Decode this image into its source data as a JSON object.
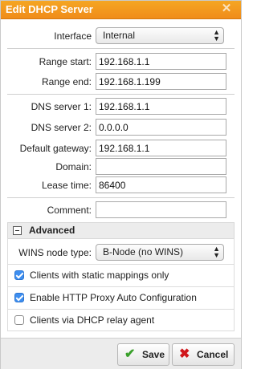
{
  "dialog": {
    "title": "Edit DHCP Server"
  },
  "form": {
    "interface": {
      "label": "Interface",
      "value": "Internal"
    },
    "range_start": {
      "label": "Range start:",
      "value": "192.168.1.1"
    },
    "range_end": {
      "label": "Range end:",
      "value": "192.168.1.199"
    },
    "dns1": {
      "label": "DNS server 1:",
      "value": "192.168.1.1"
    },
    "dns2": {
      "label": "DNS server 2:",
      "value": "0.0.0.0"
    },
    "gateway": {
      "label": "Default gateway:",
      "value": "192.168.1.1"
    },
    "domain": {
      "label": "Domain:",
      "value": ""
    },
    "lease": {
      "label": "Lease time:",
      "value": "86400"
    },
    "comment": {
      "label": "Comment:",
      "value": ""
    }
  },
  "advanced": {
    "title": "Advanced",
    "wins": {
      "label": "WINS node type:",
      "value": "B-Node (no WINS)"
    },
    "options": [
      {
        "label": "Clients with static mappings only",
        "checked": true
      },
      {
        "label": "Enable HTTP Proxy Auto Configuration",
        "checked": true
      },
      {
        "label": "Clients via DHCP relay agent",
        "checked": false
      }
    ]
  },
  "buttons": {
    "save": "Save",
    "cancel": "Cancel"
  },
  "colors": {
    "title_bar": "#f39a1f",
    "save_icon": "#3aa02b",
    "cancel_icon": "#d0161b",
    "checkbox": "#3d8ef0"
  }
}
